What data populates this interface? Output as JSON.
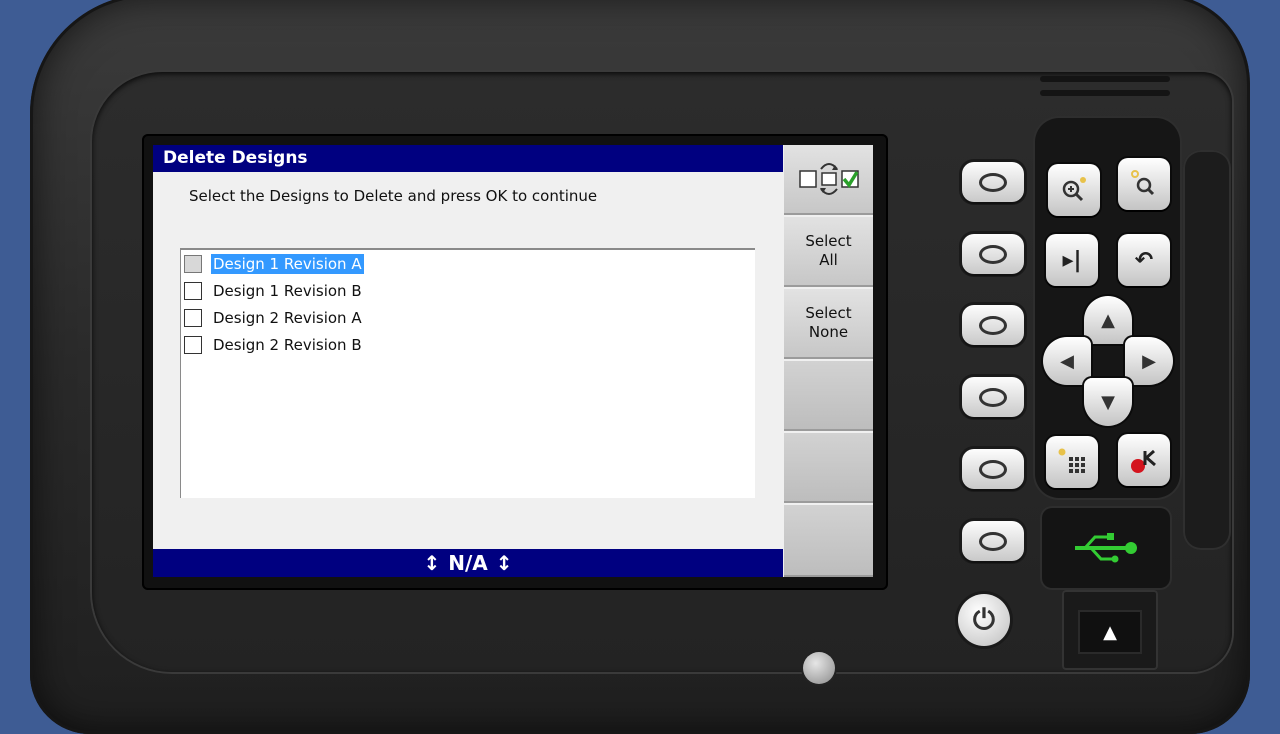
{
  "window": {
    "title": "Delete Designs"
  },
  "instruction": "Select the Designs to Delete and press OK to continue",
  "designs": [
    {
      "label": "Design 1 Revision A",
      "checked": false,
      "selected": true
    },
    {
      "label": "Design 1 Revision B",
      "checked": false,
      "selected": false
    },
    {
      "label": "Design 2 Revision A",
      "checked": false,
      "selected": false
    },
    {
      "label": "Design 2 Revision B",
      "checked": false,
      "selected": false
    }
  ],
  "status": {
    "text": "N/A",
    "left_icon": "up-down-arrow-icon",
    "right_icon": "up-down-arrow-icon"
  },
  "softkeys": {
    "toggle_icon": "checkbox-toggle-icon",
    "select_all": "Select\nAll",
    "select_all_line1": "Select",
    "select_all_line2": "All",
    "select_none_line1": "Select",
    "select_none_line2": "None"
  },
  "keypad": {
    "zoom_in_icon": "zoom-in-icon",
    "zoom_icon": "zoom-icon",
    "skip_icon": "skip-end-icon",
    "undo_icon": "undo-icon",
    "dpad_icons": [
      "up-arrow-icon",
      "left-arrow-icon",
      "right-arrow-icon",
      "down-arrow-icon"
    ],
    "grid_icon": "keypad-grid-icon",
    "ok_icon": "ok-key-icon",
    "usb_icon": "usb-icon",
    "eject_icon": "eject-icon",
    "power_icon": "power-icon"
  },
  "colors": {
    "title_bar": "#000080",
    "selection": "#3399ff",
    "usb": "#33cc33"
  }
}
